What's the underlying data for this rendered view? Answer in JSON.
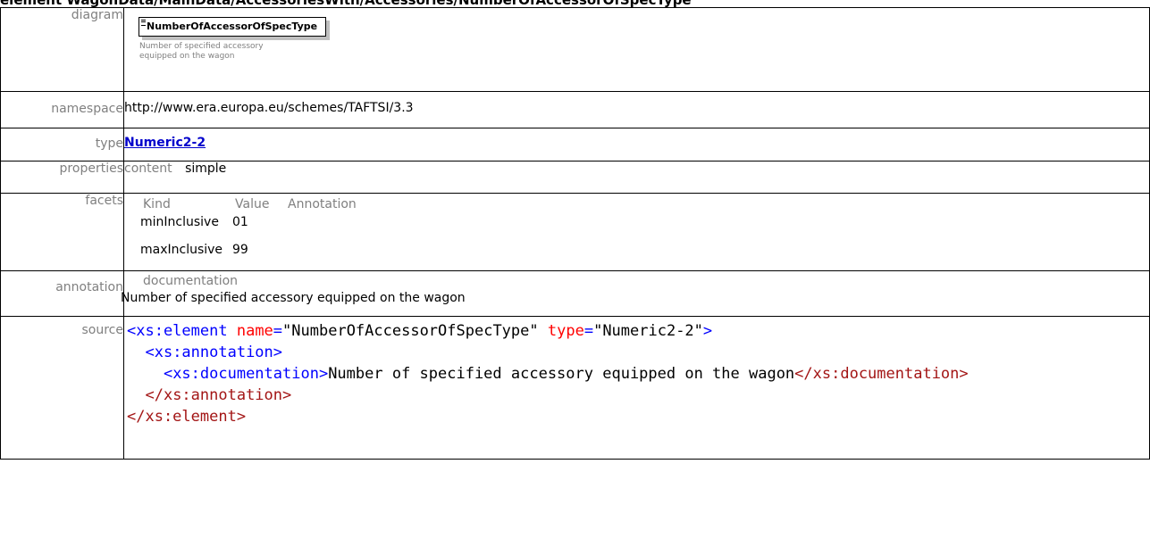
{
  "heading": "element WagonData/MainData/AccessoriesWith/Accessories/NumberOfAccessorOfSpecType",
  "rows": {
    "diagram": {
      "label": "diagram",
      "element_name": "NumberOfAccessorOfSpecType",
      "element_doc": "Number of specified accessory equipped on the wagon"
    },
    "namespace": {
      "label": "namespace",
      "value": "http://www.era.europa.eu/schemes/TAFTSI/3.3"
    },
    "type": {
      "label": "type",
      "value": "Numeric2-2"
    },
    "properties": {
      "label": "properties",
      "key": "content",
      "value": "simple"
    },
    "facets": {
      "label": "facets",
      "headers": [
        "Kind",
        "Value",
        "Annotation"
      ],
      "rows": [
        {
          "kind": "minInclusive",
          "value": "01",
          "annotation": ""
        },
        {
          "kind": "maxInclusive",
          "value": "99",
          "annotation": ""
        }
      ]
    },
    "annotation": {
      "label": "annotation",
      "subhead": "documentation",
      "text": "Number of specified accessory equipped on the wagon"
    },
    "source": {
      "label": "source",
      "el_open": "<xs:element",
      "attr1": "name",
      "val1": "\"NumberOfAccessorOfSpecType\"",
      "attr2": "type",
      "val2": "\"Numeric2-2\"",
      "close_gt": ">",
      "ann_open": "<xs:annotation>",
      "doc_open": "<xs:documentation>",
      "doc_text": "Number of specified accessory equipped on the wagon",
      "doc_close": "</xs:documentation>",
      "ann_close": "</xs:annotation>",
      "el_close": "</xs:element>"
    }
  }
}
